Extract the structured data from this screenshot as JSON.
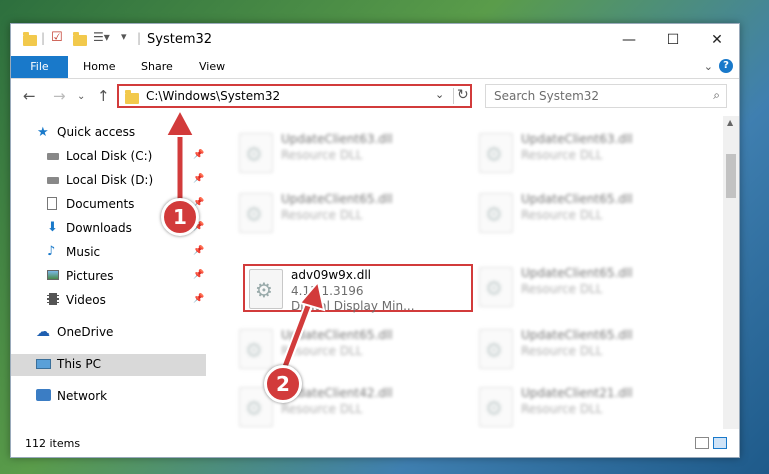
{
  "window": {
    "title": "System32",
    "controls": {
      "minimize": "—",
      "maximize": "☐",
      "close": "✕"
    }
  },
  "ribbon": {
    "tabs": [
      "File",
      "Home",
      "Share",
      "View"
    ],
    "help": "?"
  },
  "address": {
    "path": "C:\\Windows\\System32",
    "search_placeholder": "Search System32"
  },
  "sidebar": {
    "items": [
      {
        "label": "Quick access",
        "icon": "star-icon"
      },
      {
        "label": "Local Disk (C:)",
        "icon": "drive-icon",
        "pinned": true
      },
      {
        "label": "Local Disk (D:)",
        "icon": "drive-icon",
        "pinned": true
      },
      {
        "label": "Documents",
        "icon": "documents-icon",
        "pinned": true
      },
      {
        "label": "Downloads",
        "icon": "downloads-icon",
        "pinned": true
      },
      {
        "label": "Music",
        "icon": "music-icon",
        "pinned": true
      },
      {
        "label": "Pictures",
        "icon": "pictures-icon",
        "pinned": true
      },
      {
        "label": "Videos",
        "icon": "videos-icon",
        "pinned": true
      },
      {
        "label": "OneDrive",
        "icon": "cloud-icon"
      },
      {
        "label": "This PC",
        "icon": "computer-icon",
        "selected": true
      },
      {
        "label": "Network",
        "icon": "network-icon"
      }
    ]
  },
  "files": {
    "highlighted": {
      "name": "adv09w9x.dll",
      "version": "4.13.1.3196",
      "description": "Digital Display Min..."
    },
    "blurred": [
      {
        "name": "UpdateClient63.dll",
        "type": "Resource DLL"
      },
      {
        "name": "UpdateClient63.dll",
        "type": "Resource DLL"
      },
      {
        "name": "UpdateClient65.dll",
        "type": "Resource DLL"
      },
      {
        "name": "UpdateClient65.dll",
        "type": "Resource DLL"
      },
      {
        "name": "UpdateClient65.dll",
        "type": "Resource DLL"
      },
      {
        "name": "UpdateClient65.dll",
        "type": "Resource DLL"
      },
      {
        "name": "UpdateClient65.dll",
        "type": "Resource DLL"
      },
      {
        "name": "UpdateClient42.dll",
        "type": "Resource DLL"
      },
      {
        "name": "UpdateClient21.dll",
        "type": "Resource DLL"
      }
    ]
  },
  "status": {
    "items_count": "112 items"
  },
  "callouts": {
    "one": "1",
    "two": "2"
  },
  "colors": {
    "accent": "#1979ca",
    "highlight": "#d23b3b"
  }
}
